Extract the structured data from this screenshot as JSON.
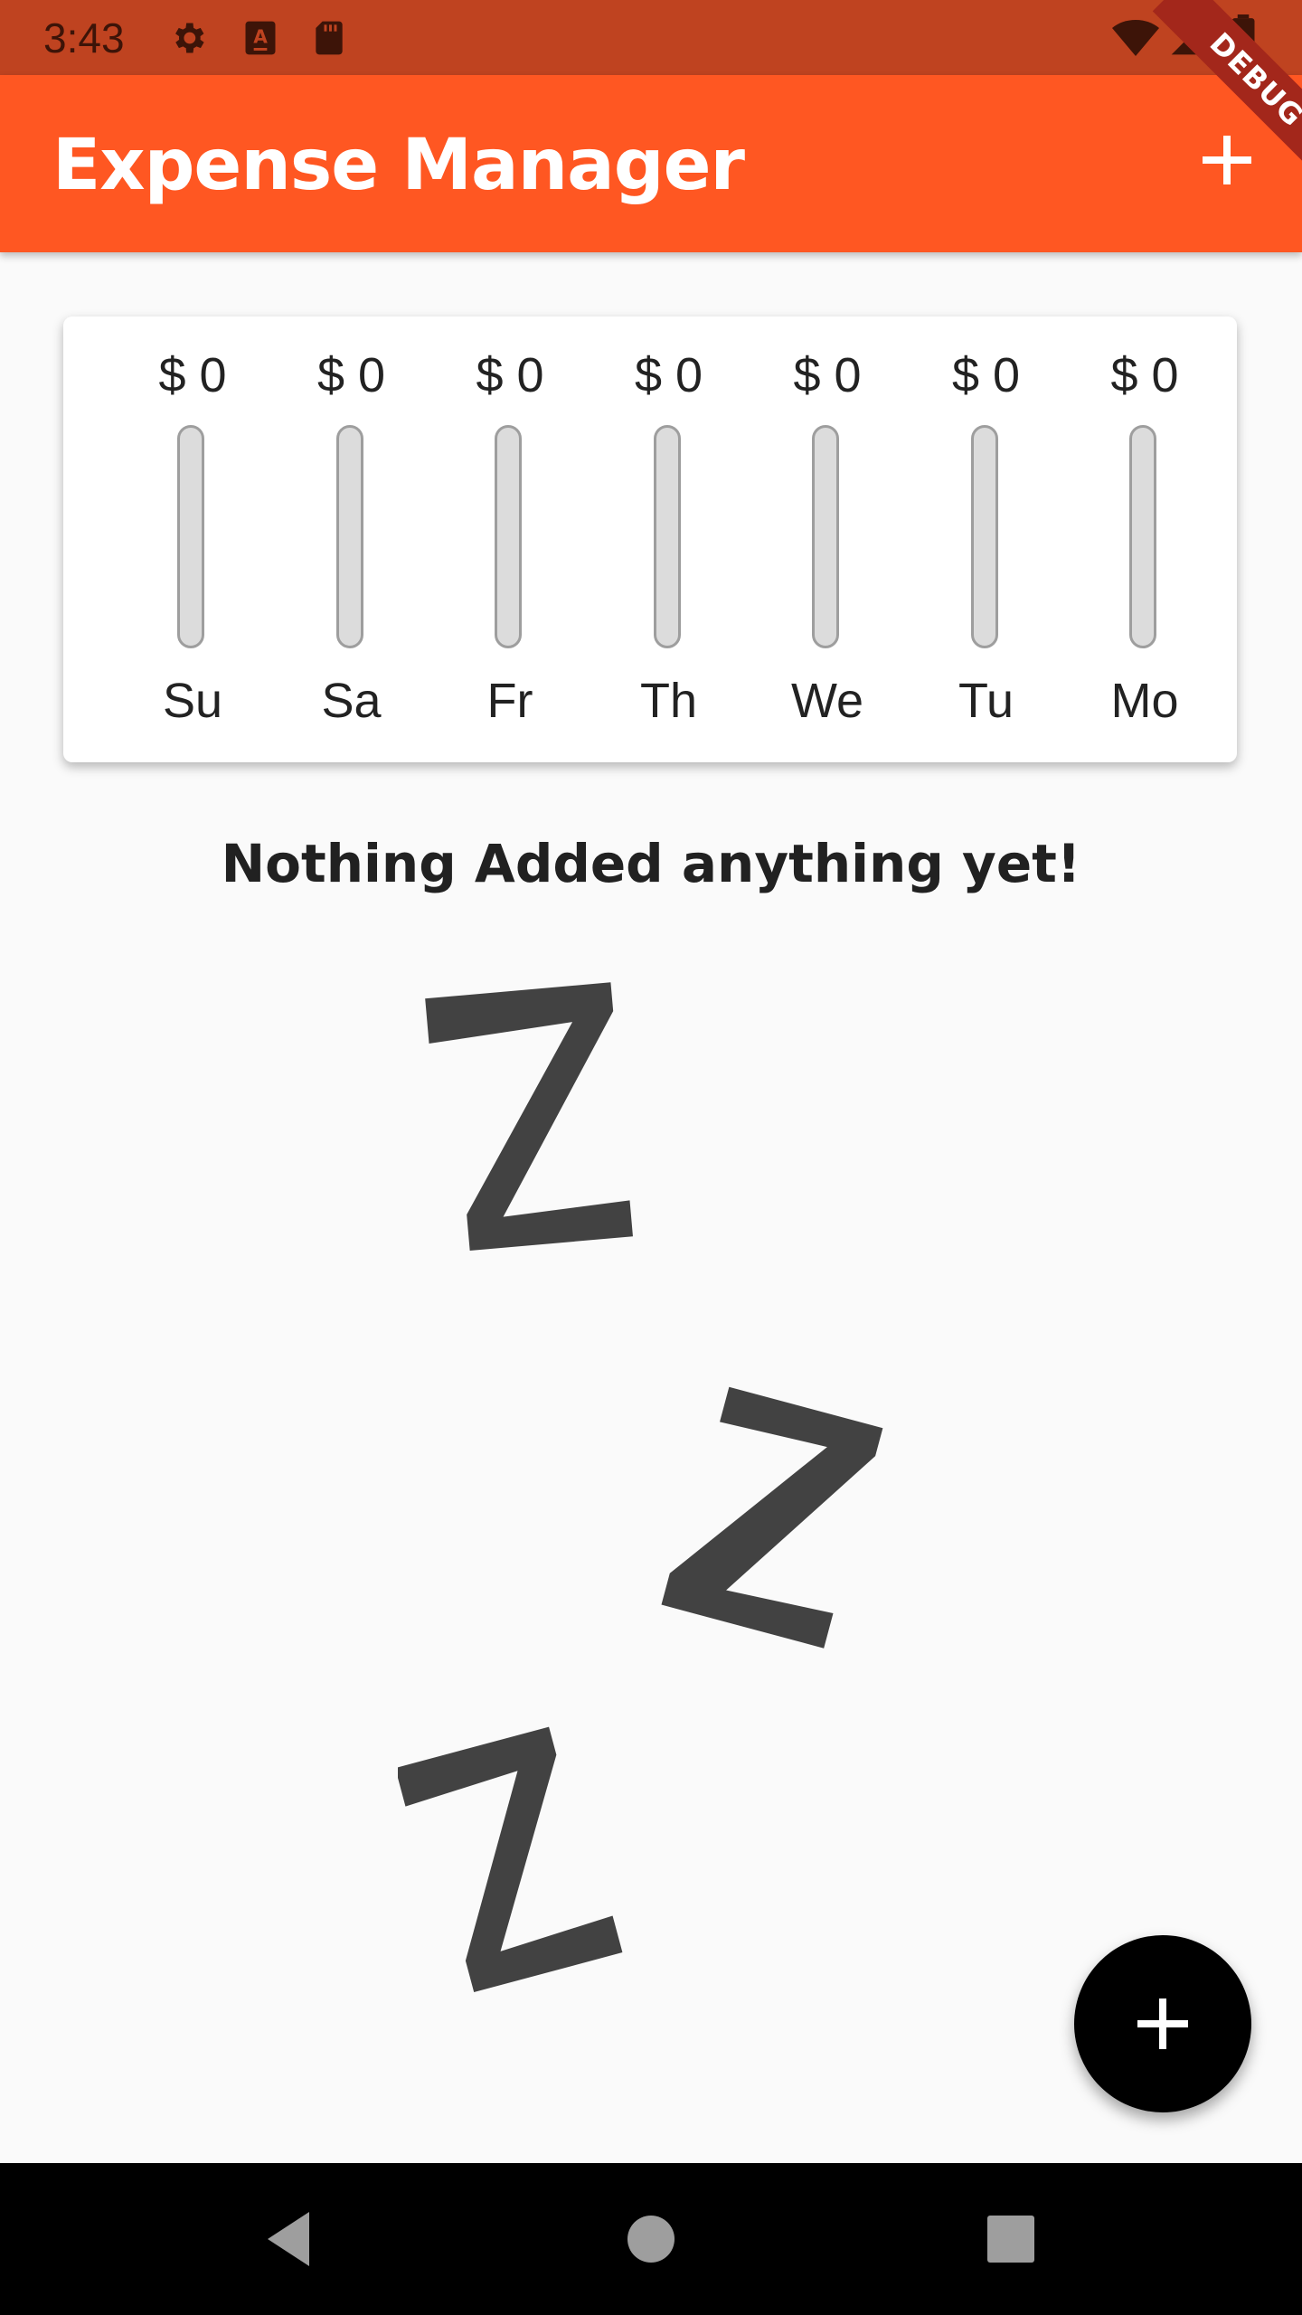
{
  "status_bar": {
    "time": "3:43",
    "icons": [
      "gear-icon",
      "keyboard-a-icon",
      "sd-card-icon",
      "wifi-icon",
      "cell-signal-icon",
      "battery-icon"
    ]
  },
  "debug_banner": {
    "label": "DEBUG"
  },
  "app_bar": {
    "title": "Expense Manager",
    "action_icon": "plus-icon"
  },
  "chart": {
    "days": [
      {
        "label": "Su",
        "amount": "$ 0",
        "fill": 0
      },
      {
        "label": "Sa",
        "amount": "$ 0",
        "fill": 0
      },
      {
        "label": "Fr",
        "amount": "$ 0",
        "fill": 0
      },
      {
        "label": "Th",
        "amount": "$ 0",
        "fill": 0
      },
      {
        "label": "We",
        "amount": "$ 0",
        "fill": 0
      },
      {
        "label": "Tu",
        "amount": "$ 0",
        "fill": 0
      },
      {
        "label": "Mo",
        "amount": "$ 0",
        "fill": 0
      }
    ]
  },
  "empty_state": {
    "message": "Nothing Added anything yet!",
    "image": "sleeping-zzz"
  },
  "fab": {
    "icon": "plus-icon"
  },
  "nav_bar": {
    "buttons": [
      "back-icon",
      "home-icon",
      "recents-icon"
    ]
  },
  "colors": {
    "primary": "#ff5722",
    "status_bar": "#bf4320",
    "accent": "#000000",
    "bar_empty": "#dcdcdc",
    "zzz": "#424242"
  }
}
